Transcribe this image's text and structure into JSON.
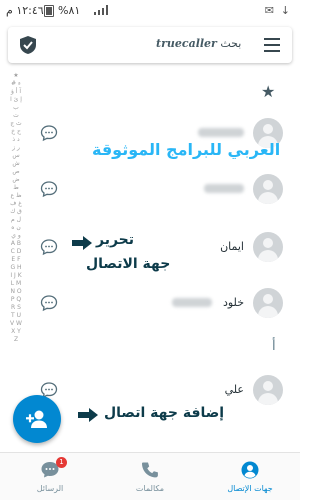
{
  "status_bar": {
    "time": "١٢:٤٦ م",
    "battery": "%٨١"
  },
  "search": {
    "brand": "truecaller",
    "placeholder_suffix": "بحث"
  },
  "alpha_index": "★ # ء آ أ ؤ إ ئ ا ب ت ث ج ح خ د ذ ر ز س ش ص ض ط ظ ع غ ف ق ك ل م ن ه و ي A B C D E F G H I J K L M N O P Q R S T U V W X Y Z",
  "favorites_icon": "star-icon",
  "contacts": [
    {
      "name": ""
    },
    {
      "name": ""
    },
    {
      "name": "ايمان"
    },
    {
      "name": "خلود"
    },
    {
      "name": "علي"
    }
  ],
  "section_letter": "أ",
  "annotations": {
    "watermark": "العربي للبرامج الموثوقة",
    "edit_line1": "تحرير",
    "edit_line2": "جهة الاتصال",
    "add_contact": "إضافة جهة اتصال"
  },
  "fab": {
    "icon": "add-contact-icon"
  },
  "bottom_nav": {
    "messages": {
      "label": "الرسائل",
      "badge": "1"
    },
    "calls": {
      "label": "مكالمات"
    },
    "contacts": {
      "label": "جهات الإتصال"
    }
  },
  "colors": {
    "accent": "#0288d1",
    "annotation_cyan": "#29b6f6",
    "annotation_dark": "#0d3b4a",
    "badge": "#e53935"
  }
}
